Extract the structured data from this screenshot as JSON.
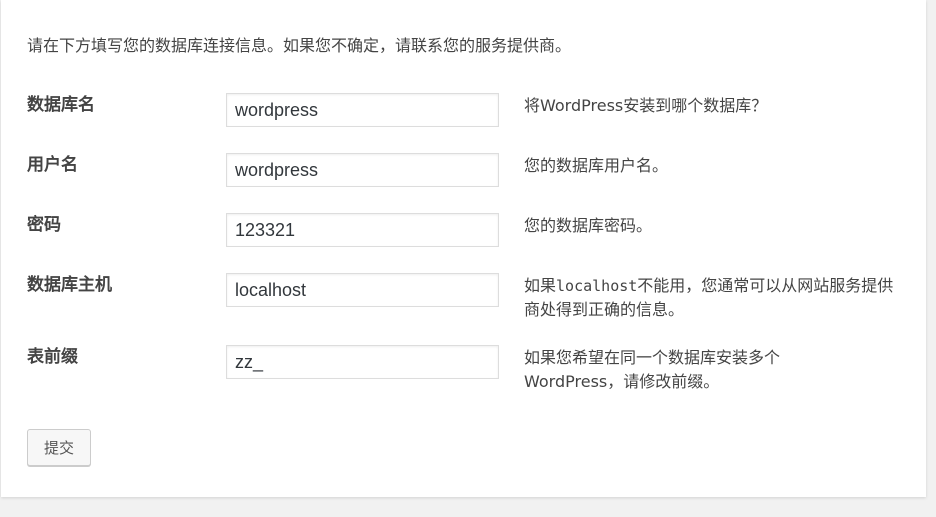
{
  "intro": "请在下方填写您的数据库连接信息。如果您不确定，请联系您的服务提供商。",
  "fields": [
    {
      "label": "数据库名",
      "value": "wordpress",
      "description": "将WordPress安装到哪个数据库？"
    },
    {
      "label": "用户名",
      "value": "wordpress",
      "description": "您的数据库用户名。"
    },
    {
      "label": "密码",
      "value": "123321",
      "description": "您的数据库密码。"
    },
    {
      "label": "数据库主机",
      "value": "localhost",
      "description_prefix": "如果",
      "description_code": "localhost",
      "description_suffix": "不能用，您通常可以从网站服务提供商处得到正确的信息。"
    },
    {
      "label": "表前缀",
      "value": "zz_",
      "description_line1": "如果您希望在同一个数据库安装多个",
      "description_line2": "WordPress，请修改前缀。"
    }
  ],
  "submit_label": "提交"
}
